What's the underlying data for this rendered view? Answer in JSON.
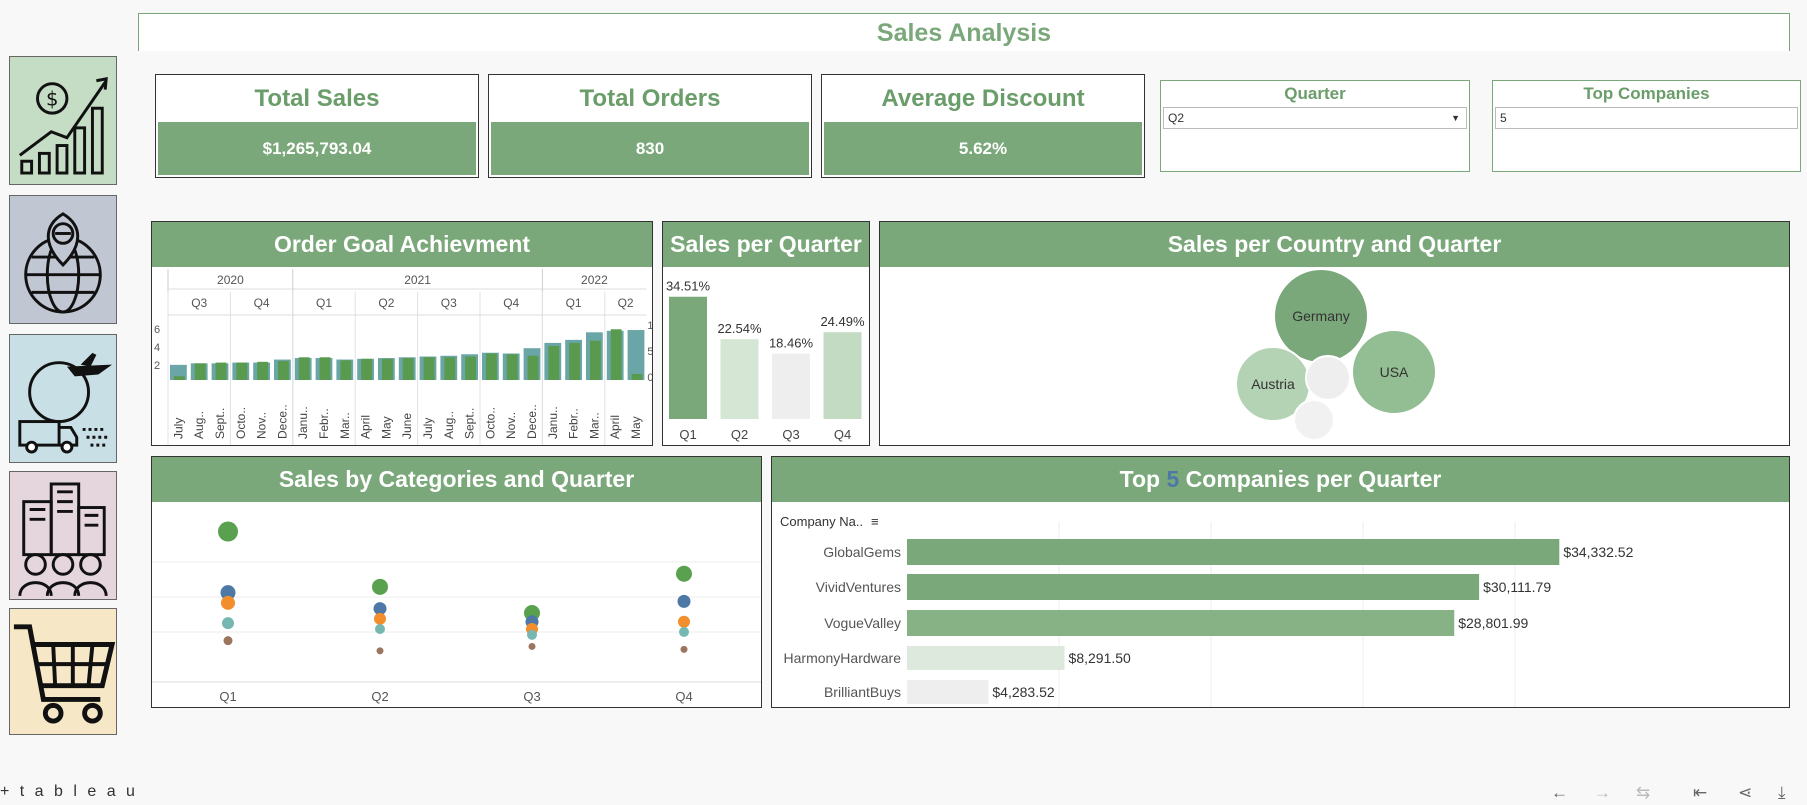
{
  "title": "Sales Analysis",
  "nav": [
    {
      "icon": "sales-growth-icon"
    },
    {
      "icon": "globe-location-icon"
    },
    {
      "icon": "shipping-logistics-icon"
    },
    {
      "icon": "company-employees-icon"
    },
    {
      "icon": "shopping-cart-icon"
    }
  ],
  "kpis": {
    "total_sales": {
      "label": "Total Sales",
      "value": "$1,265,793.04"
    },
    "total_orders": {
      "label": "Total Orders",
      "value": "830"
    },
    "avg_discount": {
      "label": "Average Discount",
      "value": "5.62%"
    }
  },
  "filters": {
    "quarter": {
      "label": "Quarter",
      "value": "Q2"
    },
    "top_companies": {
      "label": "Top Companies",
      "value": "5"
    }
  },
  "panels": {
    "order_goal": "Order Goal Achievment",
    "sales_quarter": "Sales per Quarter",
    "sales_country": "Sales per Country and Quarter",
    "sales_categories": "Sales by Categories and Quarter",
    "top_companies": {
      "prefix": "Top ",
      "n": "5",
      "suffix": " Companies per Quarter"
    }
  },
  "colors": {
    "accent": "#7aa87a",
    "accent_dark": "#5a9a4f",
    "highlight": "#4e79a7",
    "teal": "#6aa6a8"
  },
  "chart_data": [
    {
      "type": "bar",
      "title": "Order Goal Achievment",
      "years": [
        {
          "label": "2020",
          "months": 6
        },
        {
          "label": "2021",
          "months": 12
        },
        {
          "label": "2022",
          "months": 5
        }
      ],
      "quarters": [
        "Q3",
        "Q4",
        "Q1",
        "Q2",
        "Q3",
        "Q4",
        "Q1",
        "Q2"
      ],
      "categories": [
        "July",
        "Aug..",
        "Sept..",
        "Octo..",
        "Nov..",
        "Dece..",
        "Janu..",
        "Febr..",
        "Mar..",
        "April",
        "May",
        "June",
        "July",
        "Aug..",
        "Sept..",
        "Octo..",
        "Nov..",
        "Dece..",
        "Janu..",
        "Febr..",
        "Mar..",
        "April",
        "May"
      ],
      "y_ticks_left": [
        "6",
        "4",
        "2"
      ],
      "y_ticks_right": [
        "1",
        "5",
        "0"
      ],
      "series": [
        {
          "name": "Goal",
          "values": [
            20,
            22,
            22,
            23,
            23,
            27,
            29,
            29,
            27,
            28,
            29,
            30,
            31,
            32,
            34,
            36,
            35,
            42,
            49,
            53,
            63,
            65,
            66
          ]
        },
        {
          "name": "Orders",
          "values": [
            5,
            22,
            23,
            23,
            24,
            25,
            30,
            30,
            26,
            28,
            28,
            29,
            30,
            30,
            31,
            35,
            34,
            32,
            45,
            49,
            52,
            67,
            8
          ]
        }
      ],
      "ylim": [
        0,
        70
      ]
    },
    {
      "type": "bar",
      "title": "Sales per Quarter",
      "categories": [
        "Q1",
        "Q2",
        "Q3",
        "Q4"
      ],
      "values": [
        34.51,
        22.54,
        18.46,
        24.49
      ],
      "labels": [
        "34.51%",
        "22.54%",
        "18.46%",
        "24.49%"
      ],
      "ylim": [
        0,
        35
      ]
    },
    {
      "type": "scatter",
      "title": "Sales per Country and Quarter",
      "bubbles": [
        {
          "label": "Germany",
          "size": 47
        },
        {
          "label": "USA",
          "size": 42
        },
        {
          "label": "Austria",
          "size": 37
        },
        {
          "label": "",
          "size": 22
        },
        {
          "label": "",
          "size": 20
        }
      ]
    },
    {
      "type": "scatter",
      "title": "Sales by Categories and Quarter",
      "categories": [
        "Q1",
        "Q2",
        "Q3",
        "Q4"
      ],
      "series": [
        {
          "values": [
            100,
            62,
            44,
            71
          ]
        },
        {
          "values": [
            58,
            47,
            38,
            52
          ]
        },
        {
          "values": [
            51,
            40,
            33,
            38
          ]
        },
        {
          "values": [
            37,
            33,
            29,
            31
          ]
        },
        {
          "values": [
            25,
            18,
            21,
            19
          ]
        }
      ],
      "ylim": [
        0,
        110
      ]
    },
    {
      "type": "bar",
      "title": "Top 5 Companies per Quarter",
      "axis_label": "Company Na..",
      "categories": [
        "GlobalGems",
        "VividVentures",
        "VogueValley",
        "HarmonyHardware",
        "BrilliantBuys"
      ],
      "values": [
        34332.52,
        30111.79,
        28801.99,
        8291.5,
        4283.52
      ],
      "labels": [
        "$34,332.52",
        "$30,111.79",
        "$28,801.99",
        "$8,291.50",
        "$4,283.52"
      ],
      "xlim": [
        0,
        40000
      ]
    }
  ],
  "footer": {
    "logo": "+ t a b l e a u",
    "icons": [
      "undo-icon",
      "redo-icon",
      "revert-icon",
      "reset-icon",
      "share-icon",
      "download-icon"
    ]
  }
}
